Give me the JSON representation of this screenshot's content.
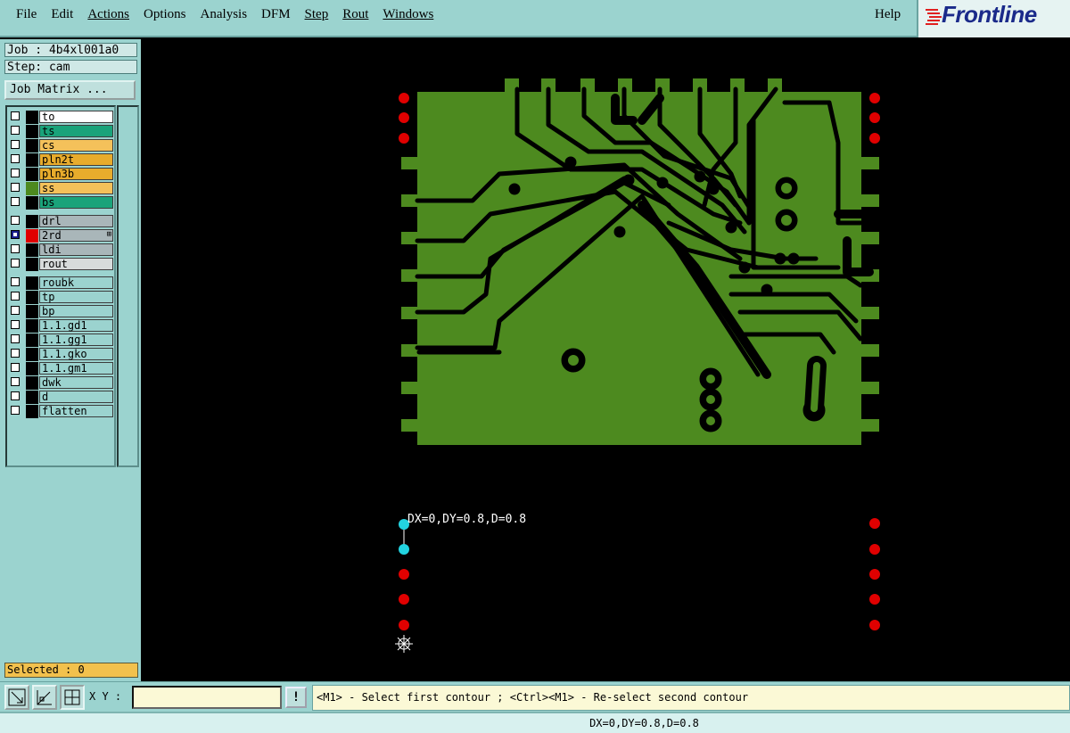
{
  "menubar": {
    "menus": [
      {
        "label": "File",
        "underline": false
      },
      {
        "label": "Edit",
        "underline": false
      },
      {
        "label": "Actions",
        "underline": true
      },
      {
        "label": "Options",
        "underline": false
      },
      {
        "label": "Analysis",
        "underline": false
      },
      {
        "label": "DFM",
        "underline": false
      },
      {
        "label": "Step",
        "underline": true
      },
      {
        "label": "Rout",
        "underline": true
      },
      {
        "label": "Windows",
        "underline": true
      }
    ],
    "help": "Help",
    "logo": "Frontline"
  },
  "left_panel": {
    "job": "Job : 4b4xl001a0",
    "step": "Step: cam",
    "job_matrix_button": "Job Matrix ...",
    "layer_groups": [
      [
        {
          "name": "to",
          "bg": "#ffffff",
          "swatch": "#000000",
          "checked": false
        },
        {
          "name": "ts",
          "bg": "#1aa37a",
          "swatch": "#000000",
          "checked": false
        },
        {
          "name": "cs",
          "bg": "#f4c15a",
          "swatch": "#000000",
          "checked": false
        },
        {
          "name": "pln2t",
          "bg": "#e8ac2c",
          "swatch": "#000000",
          "checked": false
        },
        {
          "name": "pln3b",
          "bg": "#e8ac2c",
          "swatch": "#000000",
          "checked": false
        },
        {
          "name": "ss",
          "bg": "#f4c15a",
          "swatch": "#4d8a1f",
          "checked": false
        },
        {
          "name": "bs",
          "bg": "#1aa37a",
          "swatch": "#000000",
          "checked": false
        }
      ],
      [
        {
          "name": "drl",
          "bg": "#a9b6b9",
          "swatch": "#000000",
          "checked": false
        },
        {
          "name": "2rd",
          "bg": "#a9b6b9",
          "swatch": "#e00000",
          "checked": true,
          "marker": "⊞"
        },
        {
          "name": "ldi",
          "bg": "#a9b6b9",
          "swatch": "#000000",
          "checked": false
        },
        {
          "name": "rout",
          "bg": "#d7dbdb",
          "swatch": "#000000",
          "checked": false
        }
      ],
      [
        {
          "name": "roubk",
          "bg": "#9bd3cf",
          "swatch": "#000000",
          "checked": false
        },
        {
          "name": "tp",
          "bg": "#9bd3cf",
          "swatch": "#000000",
          "checked": false
        },
        {
          "name": "bp",
          "bg": "#9bd3cf",
          "swatch": "#000000",
          "checked": false
        },
        {
          "name": "1.1.gd1",
          "bg": "#9bd3cf",
          "swatch": "#000000",
          "checked": false
        },
        {
          "name": "1.1.gg1",
          "bg": "#9bd3cf",
          "swatch": "#000000",
          "checked": false
        },
        {
          "name": "1.1.gko",
          "bg": "#9bd3cf",
          "swatch": "#000000",
          "checked": false
        },
        {
          "name": "1.1.gm1",
          "bg": "#9bd3cf",
          "swatch": "#000000",
          "checked": false
        },
        {
          "name": "dwk",
          "bg": "#9bd3cf",
          "swatch": "#000000",
          "checked": false
        },
        {
          "name": "d",
          "bg": "#9bd3cf",
          "swatch": "#000000",
          "checked": false
        },
        {
          "name": "flatten",
          "bg": "#9bd3cf",
          "swatch": "#000000",
          "checked": false
        }
      ]
    ],
    "selected": "Selected : 0"
  },
  "canvas": {
    "measurement": "DX=0,DY=0.8,D=0.8",
    "colors": {
      "copper": "#4d8a1f",
      "pad": "#e00000",
      "highlight": "#22d3e0",
      "background": "#000000"
    }
  },
  "bottom": {
    "xy_label": "X Y :",
    "xy_value": "",
    "exclaim": "!",
    "prompt": "<M1> - Select first contour ; <Ctrl><M1> - Re-select second contour",
    "status": "DX=0,DY=0.8,D=0.8"
  }
}
